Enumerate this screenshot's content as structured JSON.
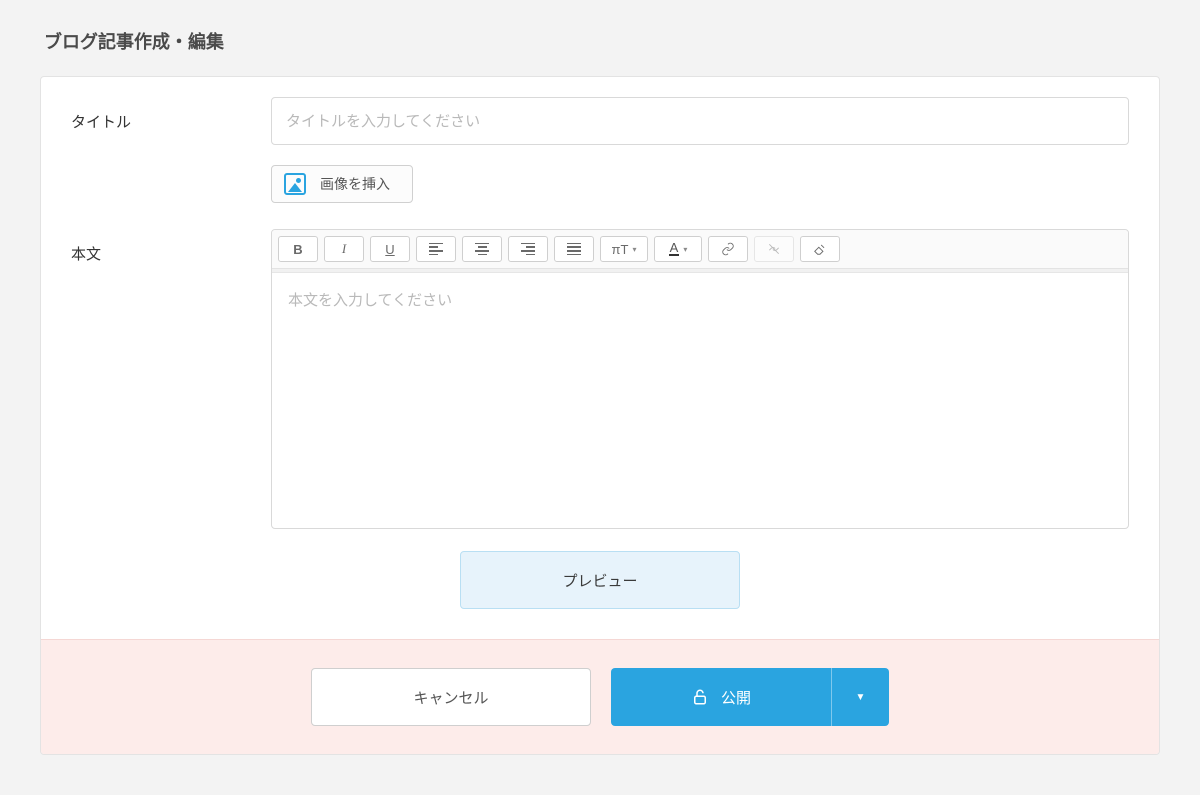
{
  "page": {
    "title": "ブログ記事作成・編集"
  },
  "form": {
    "title_label": "タイトル",
    "title_placeholder": "タイトルを入力してください",
    "insert_image_label": "画像を挿入",
    "body_label": "本文",
    "body_placeholder": "本文を入力してください"
  },
  "toolbar": {
    "bold": "B",
    "italic": "I",
    "underline": "U",
    "size": "πT",
    "color": "A"
  },
  "actions": {
    "preview": "プレビュー",
    "cancel": "キャンセル",
    "publish": "公開"
  }
}
